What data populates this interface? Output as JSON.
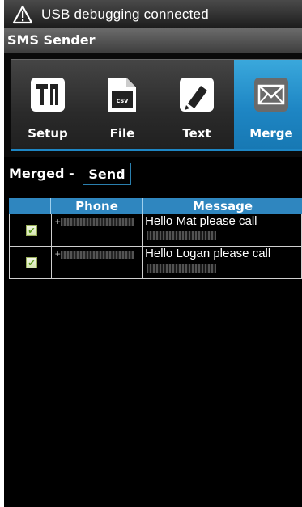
{
  "status_bar": {
    "notification_text": "USB debugging connected",
    "icon": "warning-icon"
  },
  "app_bar": {
    "title": "SMS Sender"
  },
  "tabs": [
    {
      "label": "Setup",
      "icon": "tools-icon",
      "active": false
    },
    {
      "label": "File",
      "icon": "csv-file-icon",
      "active": false
    },
    {
      "label": "Text",
      "icon": "edit-icon",
      "active": false
    },
    {
      "label": "Merge",
      "icon": "envelope-icon",
      "active": true
    }
  ],
  "merge_panel": {
    "label": "Merged -",
    "send_label": "Send"
  },
  "table": {
    "columns": [
      "",
      "Phone",
      "Message"
    ],
    "rows": [
      {
        "checked": true,
        "phone_prefix": "+",
        "message": "Hello Mat please call"
      },
      {
        "checked": true,
        "phone_prefix": "+",
        "message": "Hello Logan please call"
      }
    ]
  },
  "colors": {
    "accent": "#1e86c4",
    "header": "#2f86bf",
    "background": "#000000"
  }
}
